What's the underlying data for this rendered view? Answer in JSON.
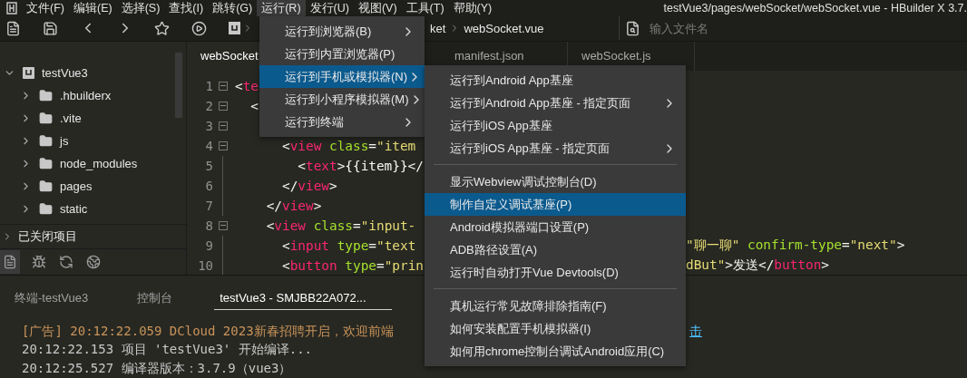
{
  "window": {
    "title": "testVue3/pages/webSocket/webSocket.vue - HBuilder X 3.7."
  },
  "menu_bar": [
    {
      "label": "文件(F)",
      "selected": false
    },
    {
      "label": "编辑(E)",
      "selected": false
    },
    {
      "label": "选择(S)",
      "selected": false
    },
    {
      "label": "查找(I)",
      "selected": false
    },
    {
      "label": "跳转(G)",
      "selected": false
    },
    {
      "label": "运行(R)",
      "selected": true
    },
    {
      "label": "发行(U)",
      "selected": false
    },
    {
      "label": "视图(V)",
      "selected": false
    },
    {
      "label": "工具(T)",
      "selected": false
    },
    {
      "label": "帮助(Y)",
      "selected": false
    }
  ],
  "toolbar": {
    "breadcrumb": [
      "ket",
      "webSocket.vue"
    ],
    "search": {
      "placeholder": "输入文件名"
    }
  },
  "sidebar": {
    "tree": [
      {
        "label": "testVue3",
        "kind": "project",
        "expanded": true,
        "children": [
          {
            "label": ".hbuilderx",
            "kind": "folder",
            "expanded": false
          },
          {
            "label": ".vite",
            "kind": "folder",
            "expanded": false
          },
          {
            "label": "js",
            "kind": "folder",
            "expanded": false
          },
          {
            "label": "node_modules",
            "kind": "folder",
            "expanded": false
          },
          {
            "label": "pages",
            "kind": "folder",
            "expanded": false
          },
          {
            "label": "static",
            "kind": "folder",
            "expanded": false
          }
        ]
      }
    ],
    "closed_projects": {
      "label": "已关闭项目",
      "expanded": false
    }
  },
  "editor": {
    "tabs": [
      {
        "label": "webSocket",
        "selected": true
      },
      {
        "label": "manifest.json",
        "selected": false
      },
      {
        "label": "webSocket.js",
        "selected": false
      }
    ],
    "lines": [
      {
        "number": "1",
        "fold": true,
        "left": [
          {
            "kind": "punct",
            "text": "<"
          },
          {
            "kind": "tag",
            "text": "te"
          }
        ]
      },
      {
        "number": "2",
        "fold": true,
        "left": [
          {
            "kind": "punct",
            "text": "  <"
          }
        ]
      },
      {
        "number": "3",
        "fold": true
      },
      {
        "number": "4",
        "fold": true,
        "left": [
          {
            "kind": "punct",
            "text": "      <"
          },
          {
            "kind": "tag",
            "text": "view"
          },
          {
            "kind": "attr",
            "text": " class"
          },
          {
            "kind": "punct",
            "text": "="
          },
          {
            "kind": "string",
            "text": "\"item"
          }
        ]
      },
      {
        "number": "5",
        "fold": false,
        "left": [
          {
            "kind": "punct",
            "text": "        <"
          },
          {
            "kind": "tag",
            "text": "text"
          },
          {
            "kind": "punct",
            "text": ">{{item}}</"
          }
        ]
      },
      {
        "number": "6",
        "fold": false,
        "left": [
          {
            "kind": "punct",
            "text": "      </"
          },
          {
            "kind": "tag",
            "text": "view"
          },
          {
            "kind": "punct",
            "text": ">"
          }
        ]
      },
      {
        "number": "7",
        "fold": false,
        "left": [
          {
            "kind": "punct",
            "text": "    </"
          },
          {
            "kind": "tag",
            "text": "view"
          },
          {
            "kind": "punct",
            "text": ">"
          }
        ]
      },
      {
        "number": "8",
        "fold": true,
        "left": [
          {
            "kind": "punct",
            "text": "    <"
          },
          {
            "kind": "tag",
            "text": "view"
          },
          {
            "kind": "attr",
            "text": " class"
          },
          {
            "kind": "punct",
            "text": "="
          },
          {
            "kind": "string",
            "text": "\"input-"
          }
        ]
      },
      {
        "number": "9",
        "fold": false,
        "left": [
          {
            "kind": "punct",
            "text": "      <"
          },
          {
            "kind": "tag",
            "text": "input"
          },
          {
            "kind": "attr",
            "text": " type"
          },
          {
            "kind": "punct",
            "text": "="
          },
          {
            "kind": "string",
            "text": "\"text"
          }
        ],
        "right": [
          {
            "kind": "string",
            "text": "\"聊一聊\""
          },
          {
            "kind": "attr",
            "text": " confirm-type"
          },
          {
            "kind": "punct",
            "text": "="
          },
          {
            "kind": "string",
            "text": "\"next\""
          },
          {
            "kind": "punct",
            "text": ">"
          }
        ]
      },
      {
        "number": "10",
        "fold": false,
        "left": [
          {
            "kind": "punct",
            "text": "      <"
          },
          {
            "kind": "tag",
            "text": "button"
          },
          {
            "kind": "attr",
            "text": " type"
          },
          {
            "kind": "punct",
            "text": "="
          },
          {
            "kind": "string",
            "text": "\"prin"
          }
        ],
        "right": [
          {
            "kind": "string",
            "text": "dBut\""
          },
          {
            "kind": "punct",
            "text": ">发送</"
          },
          {
            "kind": "tag",
            "text": "button"
          },
          {
            "kind": "punct",
            "text": ">"
          }
        ]
      }
    ]
  },
  "bottom_panel": {
    "tabs": [
      {
        "label": "终端-testVue3",
        "selected": false
      },
      {
        "label": "控制台",
        "selected": false
      },
      {
        "label": "testVue3 - SMJBB22A072...",
        "selected": true
      }
    ],
    "console": [
      {
        "kind": "ad",
        "text": "[广告] 20:12:22.059 DCloud 2023新春招聘开启，欢迎前端",
        "link": "击"
      },
      {
        "kind": "log",
        "text": "20:12:22.153 项目 'testVue3' 开始编译..."
      },
      {
        "kind": "log",
        "text": "20:12:25.527 编译器版本：3.7.9（vue3）"
      }
    ]
  },
  "run_menu": {
    "items": [
      {
        "label": "运行到浏览器(B)",
        "submenu": true,
        "selected": false
      },
      {
        "label": "运行到内置浏览器(P)",
        "submenu": false,
        "selected": false
      },
      {
        "label": "运行到手机或模拟器(N)",
        "submenu": true,
        "selected": true
      },
      {
        "label": "运行到小程序模拟器(M)",
        "submenu": true,
        "selected": false
      },
      {
        "label": "运行到终端",
        "submenu": true,
        "selected": false
      }
    ]
  },
  "device_submenu": {
    "items": [
      {
        "kind": "item",
        "label": "运行到Android App基座",
        "submenu": false,
        "selected": false
      },
      {
        "kind": "item",
        "label": "运行到Android App基座 - 指定页面",
        "submenu": true,
        "selected": false
      },
      {
        "kind": "item",
        "label": "运行到iOS App基座",
        "submenu": false,
        "selected": false
      },
      {
        "kind": "item",
        "label": "运行到iOS App基座 - 指定页面",
        "submenu": true,
        "selected": false
      },
      {
        "kind": "separator"
      },
      {
        "kind": "item",
        "label": "显示Webview调试控制台(D)",
        "submenu": false,
        "selected": false
      },
      {
        "kind": "item",
        "label": "制作自定义调试基座(P)",
        "submenu": false,
        "selected": true
      },
      {
        "kind": "item",
        "label": "Android模拟器端口设置(P)",
        "submenu": false,
        "selected": false
      },
      {
        "kind": "item",
        "label": "ADB路径设置(A)",
        "submenu": false,
        "selected": false
      },
      {
        "kind": "item",
        "label": "运行时自动打开Vue Devtools(D)",
        "submenu": false,
        "selected": false
      },
      {
        "kind": "separator"
      },
      {
        "kind": "item",
        "label": "真机运行常见故障排除指南(F)",
        "submenu": false,
        "selected": false
      },
      {
        "kind": "item",
        "label": "如何安装配置手机模拟器(I)",
        "submenu": false,
        "selected": false
      },
      {
        "kind": "item",
        "label": "如何用chrome控制台调试Android应用(C)",
        "submenu": false,
        "selected": false
      }
    ]
  }
}
